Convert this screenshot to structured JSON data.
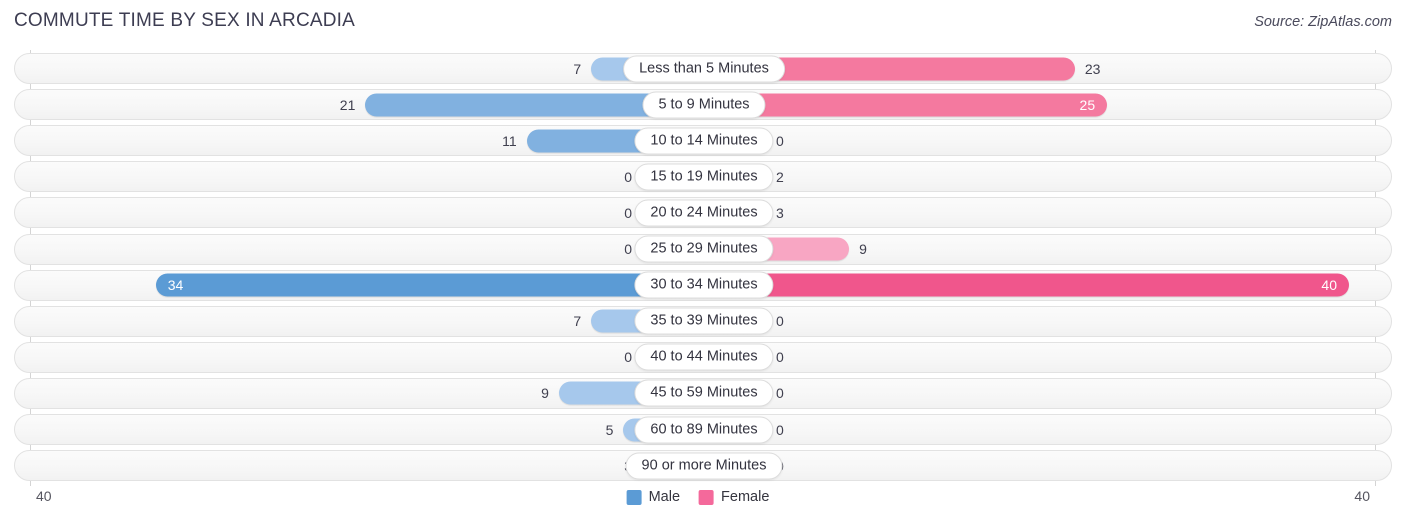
{
  "header": {
    "title": "COMMUTE TIME BY SEX IN ARCADIA",
    "source": "Source: ZipAtlas.com"
  },
  "axis": {
    "left_max_label": "40",
    "right_max_label": "40",
    "max": 40
  },
  "legend": {
    "items": [
      {
        "label": "Male",
        "color": "#5b9bd5"
      },
      {
        "label": "Female",
        "color": "#f4699b"
      }
    ]
  },
  "colors": {
    "male_strong": "#5b9bd5",
    "male_mid": "#81b1e0",
    "male_light": "#a6c8ec",
    "female_strong": "#f0568c",
    "female_mid": "#f4799f",
    "female_light": "#f8a6c3",
    "track": "#f7f7f7",
    "track_border": "#e2e2e2"
  },
  "chart_data": {
    "type": "bar",
    "title": "COMMUTE TIME BY SEX IN ARCADIA",
    "subtitle": "Source: ZipAtlas.com",
    "orientation": "horizontal-diverging",
    "xlabel": "",
    "ylabel": "",
    "xlim": [
      40,
      40
    ],
    "grid": false,
    "legend_position": "bottom-center",
    "categories": [
      "Less than 5 Minutes",
      "5 to 9 Minutes",
      "10 to 14 Minutes",
      "15 to 19 Minutes",
      "20 to 24 Minutes",
      "25 to 29 Minutes",
      "30 to 34 Minutes",
      "35 to 39 Minutes",
      "40 to 44 Minutes",
      "45 to 59 Minutes",
      "60 to 89 Minutes",
      "90 or more Minutes"
    ],
    "series": [
      {
        "name": "Male",
        "side": "left",
        "values": [
          7,
          21,
          11,
          0,
          0,
          0,
          34,
          7,
          0,
          9,
          5,
          3
        ]
      },
      {
        "name": "Female",
        "side": "right",
        "values": [
          23,
          25,
          0,
          2,
          3,
          9,
          40,
          0,
          0,
          0,
          0,
          0
        ]
      }
    ]
  },
  "rows": [
    {
      "category": "Less than 5 Minutes",
      "male": "7",
      "female": "23"
    },
    {
      "category": "5 to 9 Minutes",
      "male": "21",
      "female": "25"
    },
    {
      "category": "10 to 14 Minutes",
      "male": "11",
      "female": "0"
    },
    {
      "category": "15 to 19 Minutes",
      "male": "0",
      "female": "2"
    },
    {
      "category": "20 to 24 Minutes",
      "male": "0",
      "female": "3"
    },
    {
      "category": "25 to 29 Minutes",
      "male": "0",
      "female": "9"
    },
    {
      "category": "30 to 34 Minutes",
      "male": "34",
      "female": "40"
    },
    {
      "category": "35 to 39 Minutes",
      "male": "7",
      "female": "0"
    },
    {
      "category": "40 to 44 Minutes",
      "male": "0",
      "female": "0"
    },
    {
      "category": "45 to 59 Minutes",
      "male": "9",
      "female": "0"
    },
    {
      "category": "60 to 89 Minutes",
      "male": "5",
      "female": "0"
    },
    {
      "category": "90 or more Minutes",
      "male": "3",
      "female": "0"
    }
  ]
}
